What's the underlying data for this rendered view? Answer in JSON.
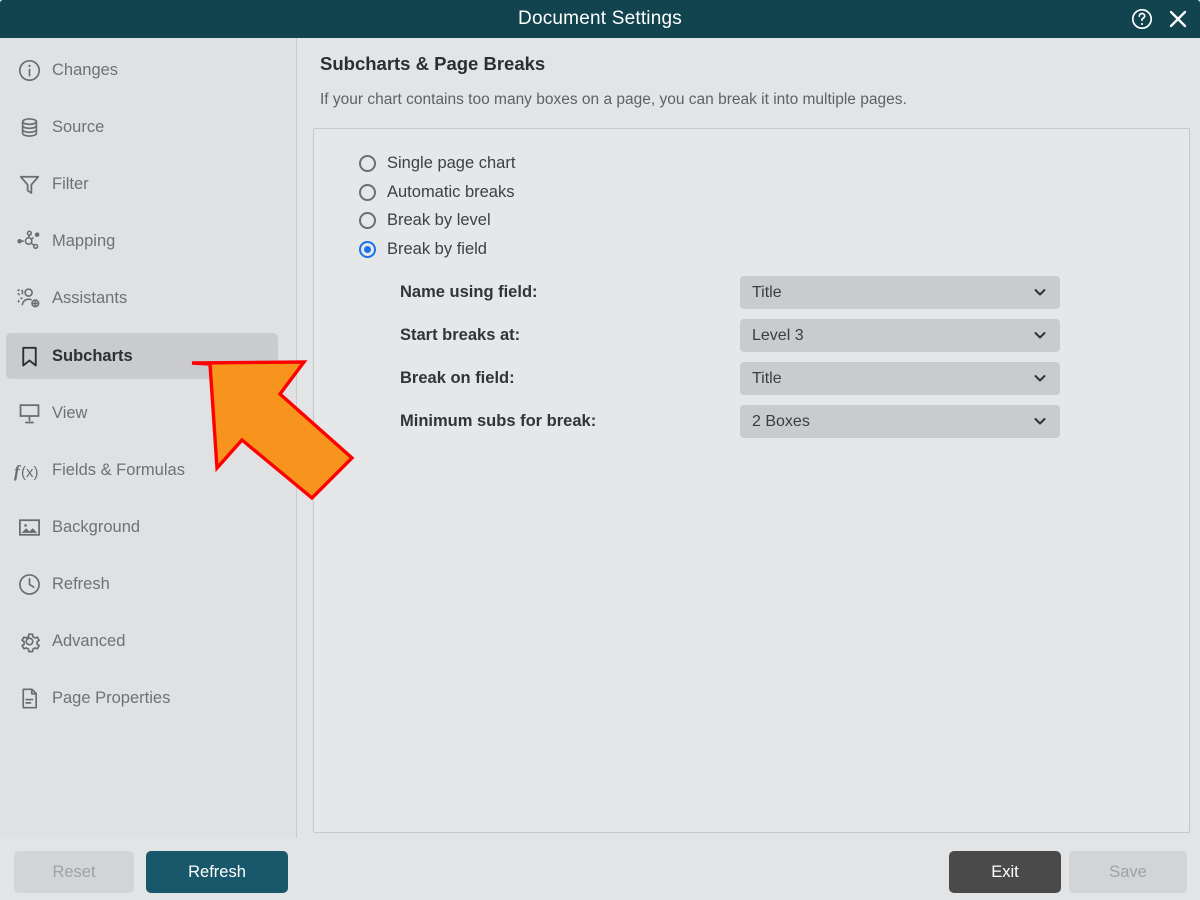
{
  "window": {
    "title": "Document Settings",
    "help_icon": "help-circle-icon",
    "close_icon": "close-icon",
    "titlebar_color": "#11444f"
  },
  "sidebar": {
    "items": [
      {
        "label": "Changes",
        "icon": "info-circle-icon",
        "selected": false
      },
      {
        "label": "Source",
        "icon": "database-icon",
        "selected": false
      },
      {
        "label": "Filter",
        "icon": "funnel-icon",
        "selected": false
      },
      {
        "label": "Mapping",
        "icon": "node-network-icon",
        "selected": false
      },
      {
        "label": "Assistants",
        "icon": "users-add-icon",
        "selected": false
      },
      {
        "label": "Subcharts",
        "icon": "bookmark-icon",
        "selected": true
      },
      {
        "label": "View",
        "icon": "presentation-icon",
        "selected": false
      },
      {
        "label": "Fields & Formulas",
        "icon": "function-fx-icon",
        "selected": false
      },
      {
        "label": "Background",
        "icon": "image-icon",
        "selected": false
      },
      {
        "label": "Refresh",
        "icon": "clock-icon",
        "selected": false
      },
      {
        "label": "Advanced",
        "icon": "gear-icon",
        "selected": false
      },
      {
        "label": "Page Properties",
        "icon": "document-icon",
        "selected": false
      }
    ]
  },
  "main": {
    "heading": "Subcharts & Page Breaks",
    "subtitle": "If your chart contains too many boxes on a page, you can break it into multiple pages.",
    "break_mode": {
      "selected": "Break by field",
      "options": [
        {
          "label": "Single page chart",
          "selected": false
        },
        {
          "label": "Automatic breaks",
          "selected": false
        },
        {
          "label": "Break by level",
          "selected": false
        },
        {
          "label": "Break by field",
          "selected": true
        }
      ]
    },
    "fields": [
      {
        "label": "Name using field:",
        "value": "Title",
        "chevron": "chevron-down-icon"
      },
      {
        "label": "Start breaks at:",
        "value": "Level 3",
        "chevron": "chevron-down-icon"
      },
      {
        "label": "Break on field:",
        "value": "Title",
        "chevron": "chevron-down-icon"
      },
      {
        "label": "Minimum subs for break:",
        "value": "2 Boxes",
        "chevron": "chevron-down-icon"
      }
    ]
  },
  "footer": {
    "reset_label": "Reset",
    "refresh_label": "Refresh",
    "exit_label": "Exit",
    "save_label": "Save",
    "reset_enabled": false,
    "refresh_enabled": true,
    "exit_enabled": true,
    "save_enabled": false,
    "primary_color": "#19586a"
  },
  "annotation": {
    "type": "arrow",
    "points_at": "sidebar-item-subcharts",
    "fill": "#F7941E",
    "stroke": "#FF0000"
  }
}
